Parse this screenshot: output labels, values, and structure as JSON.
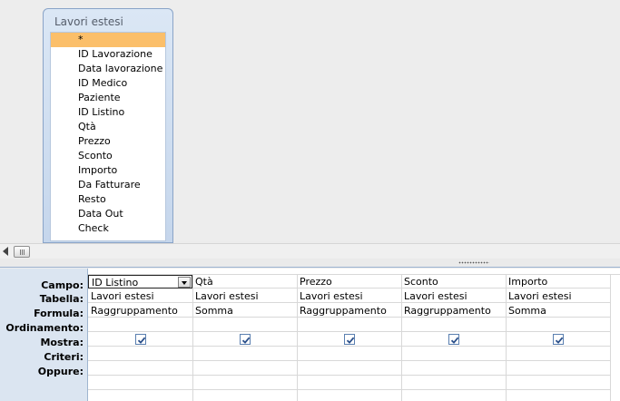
{
  "table": {
    "title": "Lavori estesi",
    "fields": [
      "*",
      "ID Lavorazione",
      "Data lavorazione",
      "ID Medico",
      "Paziente",
      "ID Listino",
      "Qtà",
      "Prezzo",
      "Sconto",
      "Importo",
      "Da Fatturare",
      "Resto",
      "Data Out",
      "Check"
    ]
  },
  "grid": {
    "row_labels": {
      "campo": "Campo:",
      "tabella": "Tabella:",
      "formula": "Formula:",
      "ordinamento": "Ordinamento:",
      "mostra": "Mostra:",
      "criteri": "Criteri:",
      "oppure": "Oppure:"
    },
    "columns": [
      {
        "campo": "ID Listino",
        "tabella": "Lavori estesi",
        "formula": "Raggruppamento",
        "mostra": true
      },
      {
        "campo": "Qtà",
        "tabella": "Lavori estesi",
        "formula": "Somma",
        "mostra": true
      },
      {
        "campo": "Prezzo",
        "tabella": "Lavori estesi",
        "formula": "Raggruppamento",
        "mostra": true
      },
      {
        "campo": "Sconto",
        "tabella": "Lavori estesi",
        "formula": "Raggruppamento",
        "mostra": true
      },
      {
        "campo": "Importo",
        "tabella": "Lavori estesi",
        "formula": "Somma",
        "mostra": true
      }
    ]
  },
  "colors": {
    "selected_field": "#fbbf6a",
    "row_header_bg": "#dbe5f1",
    "table_border": "#8aa4c8"
  }
}
